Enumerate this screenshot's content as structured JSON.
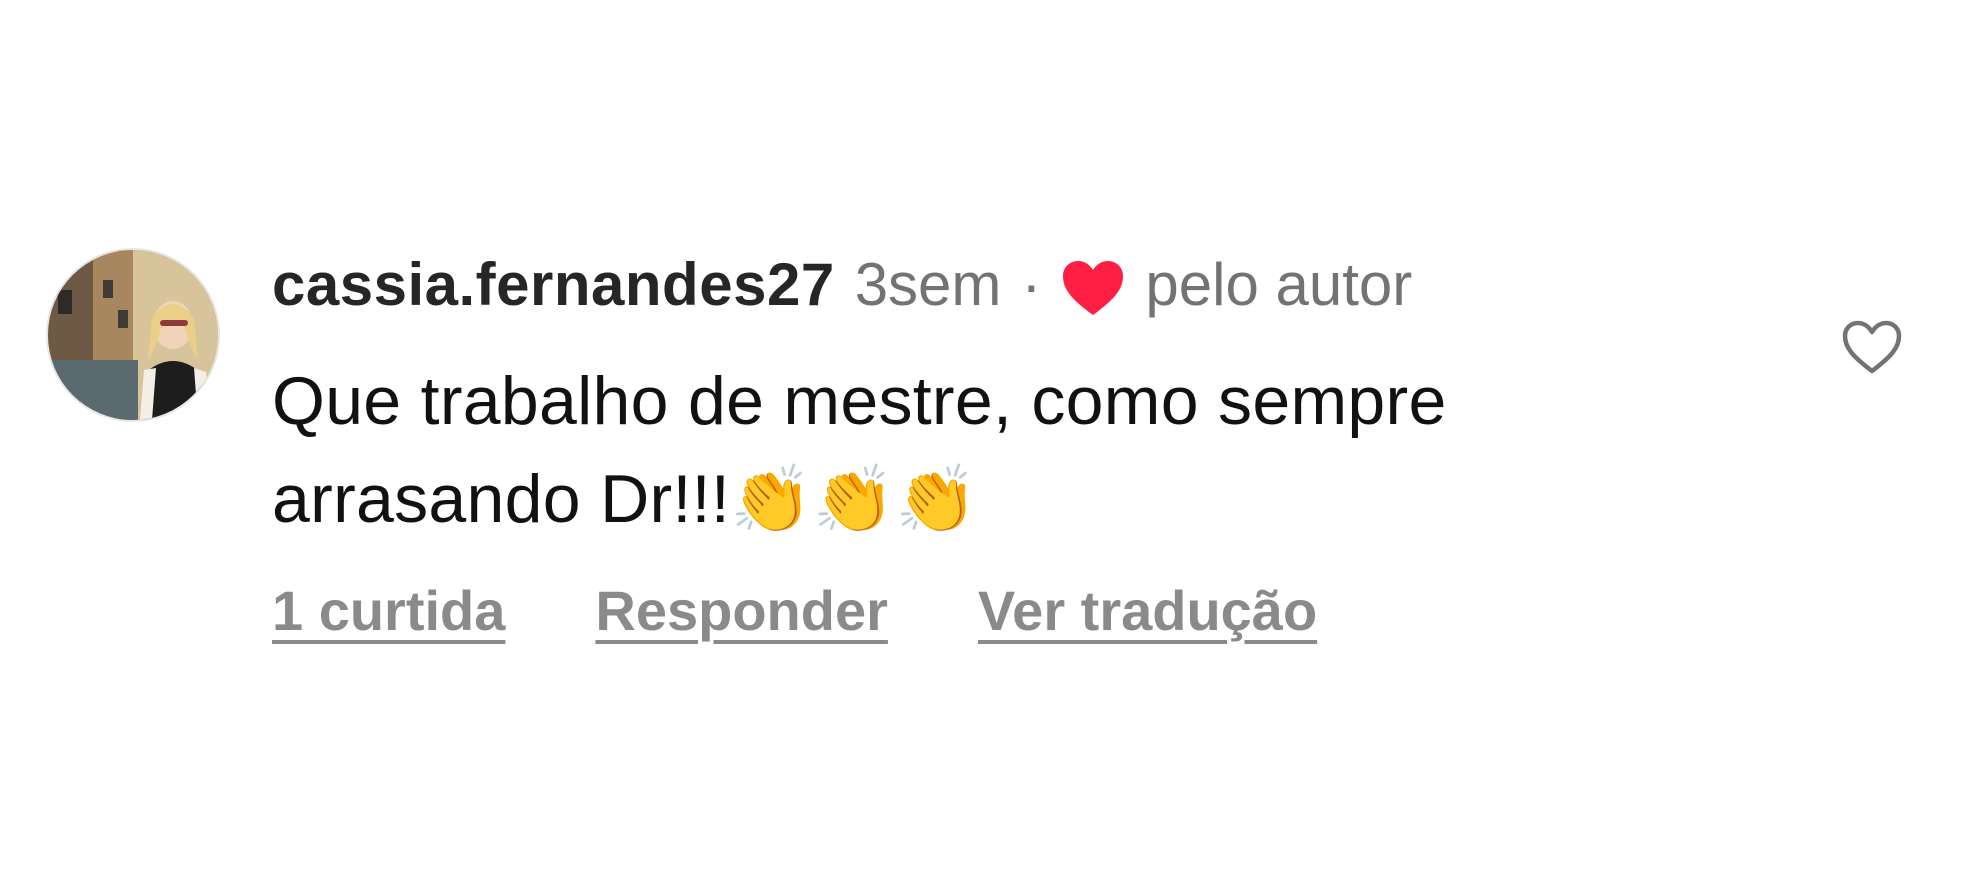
{
  "comment": {
    "username": "cassia.fernandes27",
    "age": "3sem",
    "separator": "·",
    "author_like_label": "pelo autor",
    "text": "Que trabalho de mestre, como sempre arrasando Dr!!!",
    "emojis": "👏👏👏"
  },
  "actions": {
    "likes_label": "1 curtida",
    "reply_label": "Responder",
    "translate_label": "Ver tradução"
  },
  "colors": {
    "author_heart": "#ff1f42",
    "muted_text": "#737373",
    "primary_text": "#262626"
  },
  "icons": {
    "author_like": "filled-heart-icon",
    "like_button": "outline-heart-icon",
    "avatar": "profile-photo"
  }
}
